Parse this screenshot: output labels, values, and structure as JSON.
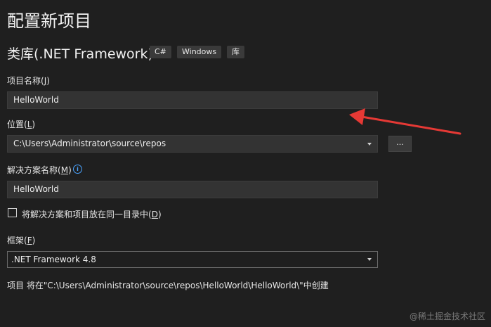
{
  "header": {
    "title": "配置新项目",
    "project_type": "类库(.NET Framework)",
    "tags": [
      "C#",
      "Windows",
      "库"
    ]
  },
  "project_name": {
    "label": "项目名称",
    "mnemonic_open": "(",
    "mnemonic_key": "J",
    "mnemonic_close": ")",
    "value": "HelloWorld"
  },
  "location": {
    "label": "位置",
    "mnemonic_open": "(",
    "mnemonic_key": "L",
    "mnemonic_close": ")",
    "value": "C:\\Users\\Administrator\\source\\repos",
    "browse_label": "..."
  },
  "solution_name": {
    "label": "解决方案名称",
    "mnemonic_open": "(",
    "mnemonic_key": "M",
    "mnemonic_close": ")",
    "info_glyph": "i",
    "value": "HelloWorld"
  },
  "same_dir": {
    "label": "将解决方案和项目放在同一目录中",
    "mnemonic_open": "(",
    "mnemonic_key": "D",
    "mnemonic_close": ")",
    "checked": false
  },
  "framework": {
    "label": "框架",
    "mnemonic_open": "(",
    "mnemonic_key": "F",
    "mnemonic_close": ")",
    "value": ".NET Framework 4.8"
  },
  "footer_text": "项目 将在\"C:\\Users\\Administrator\\source\\repos\\HelloWorld\\HelloWorld\\\"中创建",
  "watermark": "@稀土掘金技术社区",
  "colors": {
    "background": "#1f1f1f",
    "input_background": "#333333",
    "annotation_arrow": "#e53935",
    "info_icon": "#4aa3ff"
  }
}
